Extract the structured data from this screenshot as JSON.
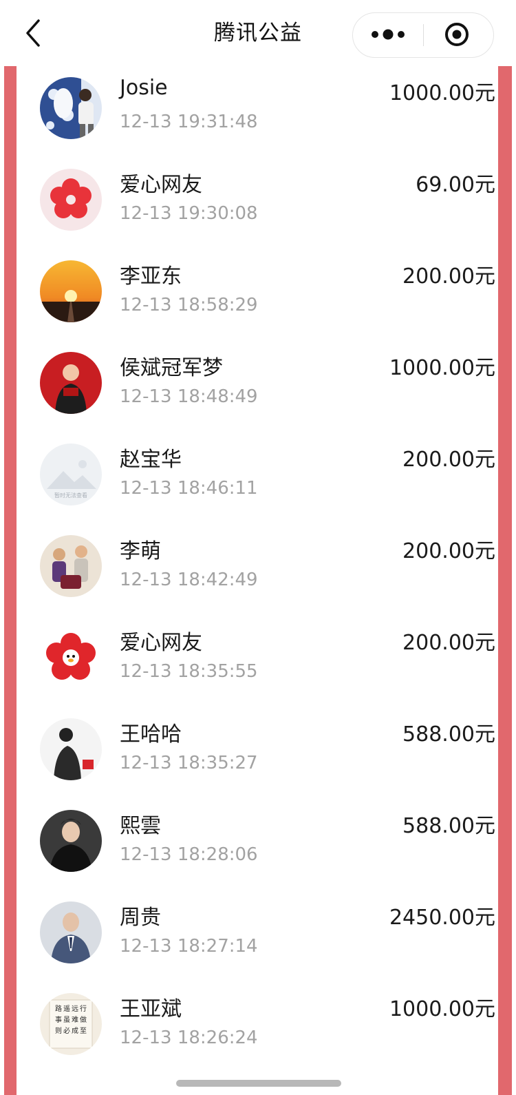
{
  "navbar": {
    "title": "腾讯公益",
    "back_icon": "chevron-left-icon",
    "more_icon": "more-dots-icon",
    "close_icon": "target-close-icon"
  },
  "theme": {
    "frame_color": "#e1686d",
    "text_color": "#1a1a1a",
    "time_color": "#a2a2a2"
  },
  "donations": [
    {
      "name": "Josie",
      "time": "12-13 19:31:48",
      "amount": "1000.00元",
      "avatar": "photo-blue-porcelain"
    },
    {
      "name": "爱心网友",
      "time": "12-13 19:30:08",
      "amount": "69.00元",
      "avatar": "red-flower"
    },
    {
      "name": "李亚东",
      "time": "12-13 18:58:29",
      "amount": "200.00元",
      "avatar": "sunset"
    },
    {
      "name": "侯斌冠军梦",
      "time": "12-13 18:48:49",
      "amount": "1000.00元",
      "avatar": "photo-red"
    },
    {
      "name": "赵宝华",
      "time": "12-13 18:46:11",
      "amount": "200.00元",
      "avatar": "placeholder-image"
    },
    {
      "name": "李萌",
      "time": "12-13 18:42:49",
      "amount": "200.00元",
      "avatar": "photo-group"
    },
    {
      "name": "爱心网友",
      "time": "12-13 18:35:55",
      "amount": "200.00元",
      "avatar": "red-flower-penguin"
    },
    {
      "name": "王哈哈",
      "time": "12-13 18:35:27",
      "amount": "588.00元",
      "avatar": "photo-sketch"
    },
    {
      "name": "熙雲",
      "time": "12-13 18:28:06",
      "amount": "588.00元",
      "avatar": "photo-dark"
    },
    {
      "name": "周贵",
      "time": "12-13 18:27:14",
      "amount": "2450.00元",
      "avatar": "photo-suit"
    },
    {
      "name": "王亚斌",
      "time": "12-13 18:26:24",
      "amount": "1000.00元",
      "avatar": "calligraphy"
    }
  ]
}
